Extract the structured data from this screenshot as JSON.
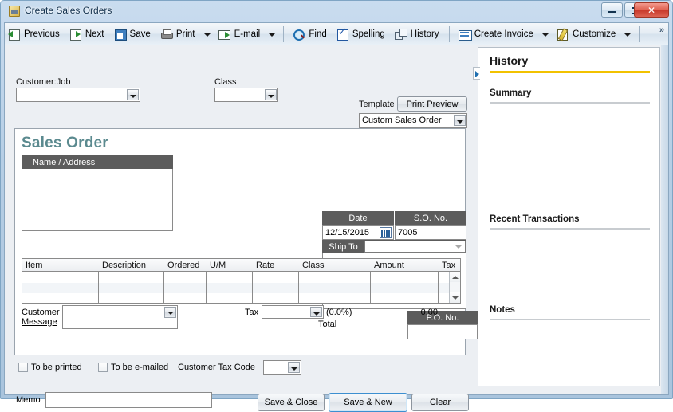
{
  "window": {
    "title": "Create Sales Orders",
    "icon": "sales-order-window-icon",
    "controls": {
      "minimize": "minimize-icon",
      "maximize": "maximize-icon",
      "close": "✕"
    }
  },
  "toolbar": {
    "overflow": "»",
    "items": [
      {
        "label": "Previous",
        "icon": "previous-arrow-icon",
        "caret": false
      },
      {
        "label": "Next",
        "icon": "next-arrow-icon",
        "caret": false
      },
      {
        "label": "Save",
        "icon": "floppy-disk-icon",
        "caret": false
      },
      {
        "label": "Print",
        "icon": "printer-icon",
        "caret": true
      },
      {
        "label": "E-mail",
        "icon": "envelope-icon",
        "caret": true
      },
      {
        "label": "Find",
        "icon": "magnifier-icon",
        "caret": false
      },
      {
        "label": "Spelling",
        "icon": "spellcheck-icon",
        "caret": false
      },
      {
        "label": "History",
        "icon": "history-cards-icon",
        "caret": false
      },
      {
        "label": "Create Invoice",
        "icon": "invoice-icon",
        "caret": true
      },
      {
        "label": "Customize",
        "icon": "customize-pencil-icon",
        "caret": true
      }
    ]
  },
  "form": {
    "customer_job": {
      "label": "Customer:Job",
      "value": "",
      "placeholder": ""
    },
    "class": {
      "label": "Class",
      "value": "",
      "placeholder": ""
    },
    "template": {
      "label": "Template",
      "value": "Custom Sales Order"
    },
    "print_preview_label": "Print Preview",
    "doc_title": "Sales Order",
    "name_address": {
      "header": "Name / Address",
      "value": ""
    },
    "date": {
      "header": "Date",
      "value": "12/15/2015",
      "calendar_icon": "calendar-icon"
    },
    "so_no": {
      "header": "S.O. No.",
      "value": "7005"
    },
    "ship_to": {
      "header": "Ship To",
      "value": "",
      "address": ""
    },
    "po_no": {
      "header": "P.O. No.",
      "value": ""
    }
  },
  "grid": {
    "columns": [
      {
        "key": "item",
        "label": "Item"
      },
      {
        "key": "description",
        "label": "Description"
      },
      {
        "key": "ordered",
        "label": "Ordered"
      },
      {
        "key": "um",
        "label": "U/M"
      },
      {
        "key": "rate",
        "label": "Rate"
      },
      {
        "key": "class",
        "label": "Class"
      },
      {
        "key": "amount",
        "label": "Amount"
      },
      {
        "key": "tax",
        "label": "Tax"
      }
    ],
    "rows": [],
    "scroll_up_icon": "scroll-up-arrow-icon",
    "scroll_down_icon": "scroll-down-arrow-icon"
  },
  "totals": {
    "customer_message_line1": "Customer",
    "customer_message_line2": "Message",
    "customer_message_value": "",
    "tax_label": "Tax",
    "tax_code_value": "",
    "tax_percent": "(0.0%)",
    "tax_amount": "0.00",
    "total_label": "Total"
  },
  "options": {
    "to_be_printed": {
      "label": "To be printed",
      "checked": false
    },
    "to_be_emailed": {
      "label": "To be e-mailed",
      "checked": false
    },
    "customer_tax_code": {
      "label": "Customer Tax Code",
      "value": ""
    }
  },
  "footer": {
    "memo_label": "Memo",
    "memo_value": "",
    "save_close_label": "Save & Close",
    "save_new_label": "Save & New",
    "clear_label": "Clear"
  },
  "history_panel": {
    "title": "History",
    "collapse_icon": "collapse-panel-arrow-icon",
    "accent_color": "#f2c200",
    "sections": [
      {
        "title": "Summary",
        "content": ""
      },
      {
        "title": "Recent Transactions",
        "content": ""
      },
      {
        "title": "Notes",
        "content": ""
      }
    ]
  },
  "colors": {
    "doc_title": "#5b8a8f",
    "dark_header": "#5c5c5c",
    "accent_yellow": "#f2c200",
    "focus_blue": "#3c8fd0",
    "close_red": "#c7392b"
  }
}
